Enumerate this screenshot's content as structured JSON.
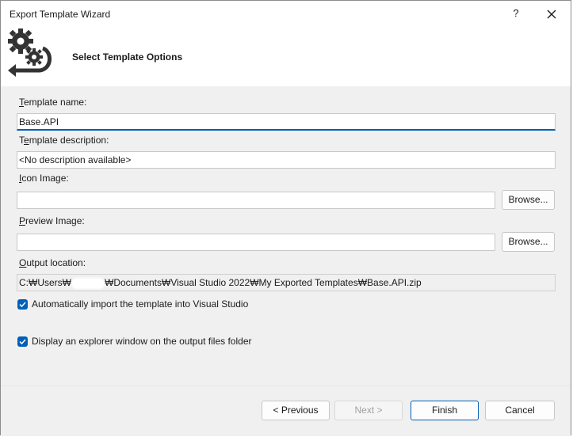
{
  "window": {
    "title": "Export Template Wizard",
    "help_glyph": "?",
    "close_icon": "close-icon"
  },
  "header": {
    "title": "Select Template Options",
    "icon": "gears-arrow-icon"
  },
  "form": {
    "template_name": {
      "label": "Template name:",
      "mnemonic": "T",
      "value": "Base.API"
    },
    "template_description": {
      "label": "Template description:",
      "mnemonic": "e",
      "value": "<No description available>"
    },
    "icon_image": {
      "label": "Icon Image:",
      "mnemonic": "I",
      "value": "",
      "browse_label": "Browse..."
    },
    "preview_image": {
      "label": "Preview Image:",
      "mnemonic": "P",
      "value": "",
      "browse_label": "Browse..."
    },
    "output_location": {
      "label": "Output location:",
      "mnemonic": "O",
      "value_prefix": "C:₩Users₩",
      "value_suffix": "₩Documents₩Visual Studio 2022₩My Exported Templates₩Base.API.zip"
    },
    "auto_import": {
      "label": "Automatically import the template into Visual Studio",
      "checked": true
    },
    "display_explorer": {
      "label": "Display an explorer window on the output files folder",
      "checked": true
    }
  },
  "footer": {
    "previous": "< Previous",
    "next": "Next >",
    "finish": "Finish",
    "cancel": "Cancel"
  },
  "colors": {
    "accent": "#005fb8",
    "background": "#f0f0f0",
    "header_bg": "#ffffff"
  }
}
